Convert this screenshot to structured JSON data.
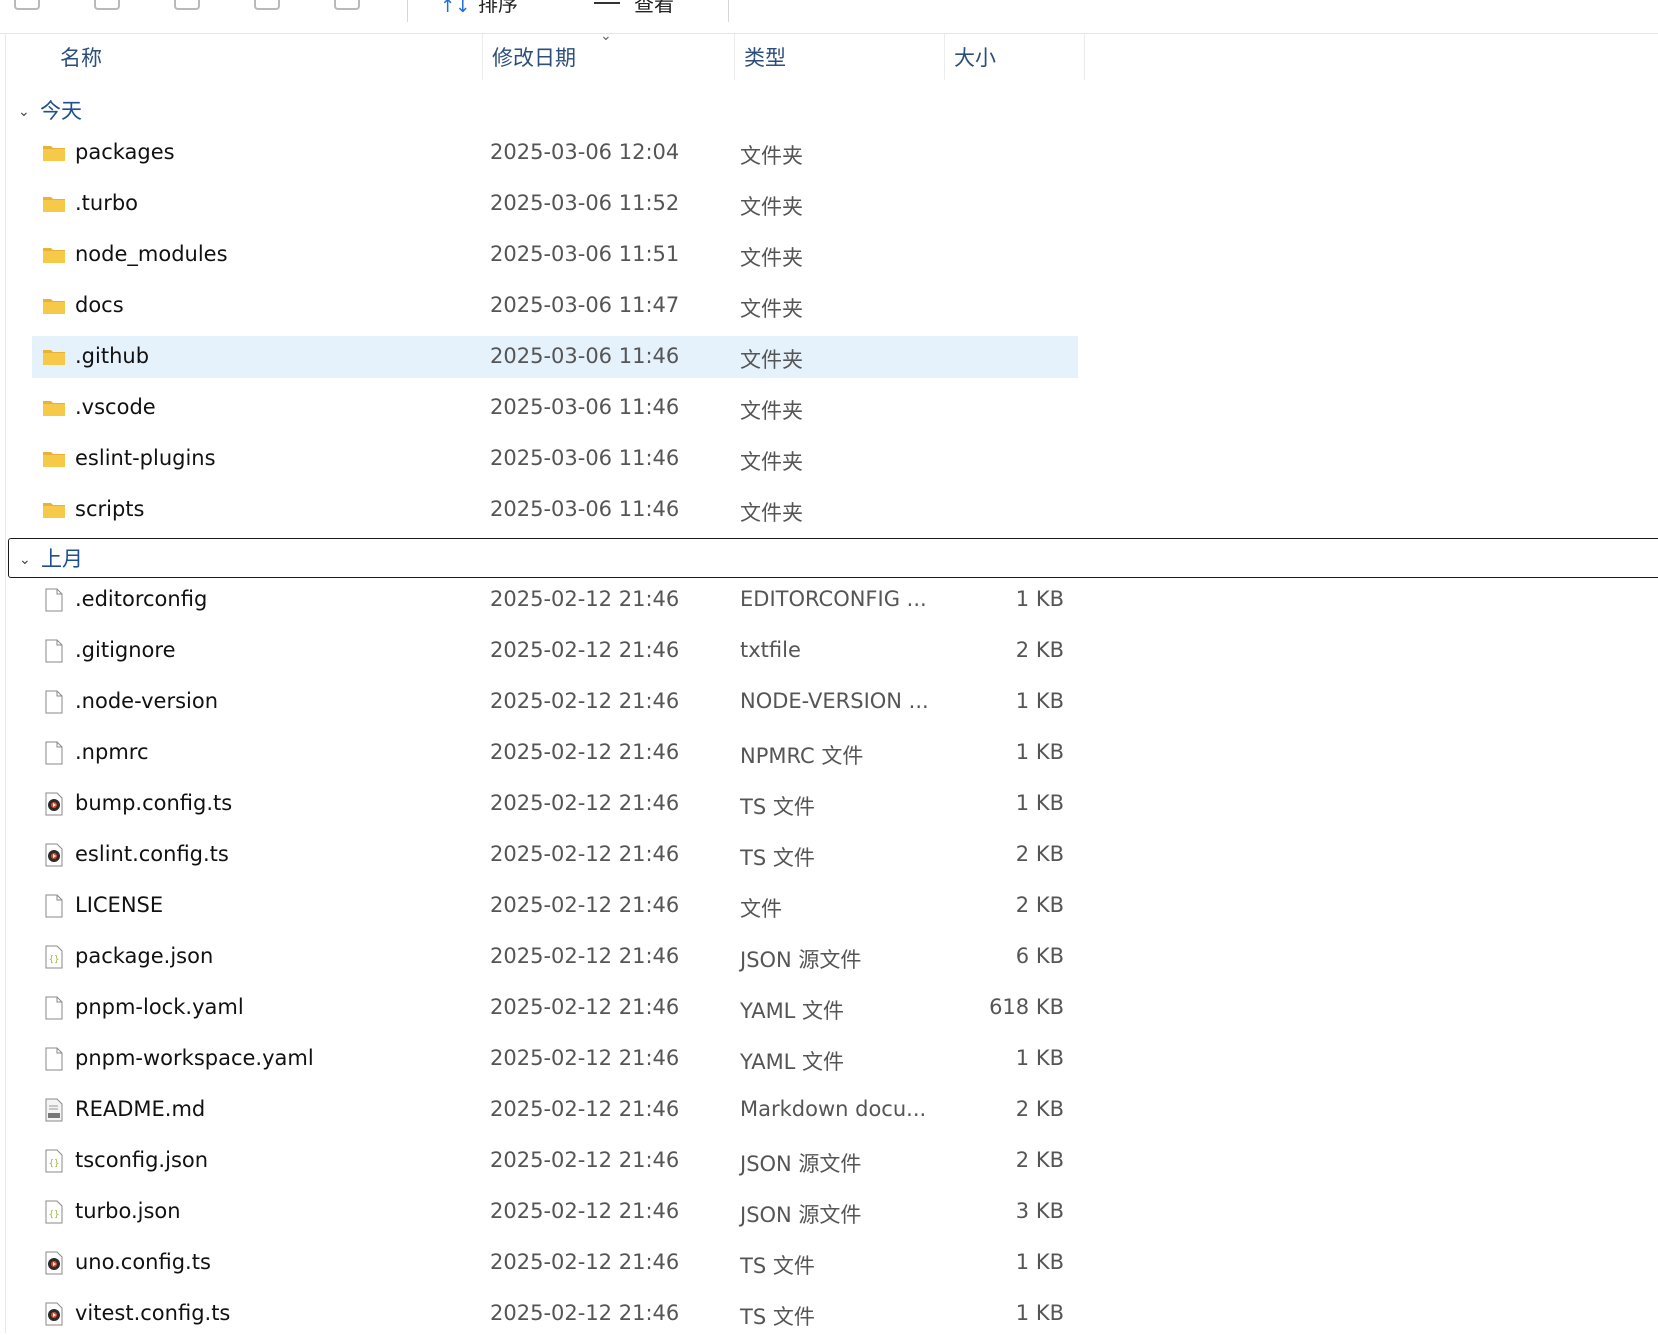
{
  "toolbar": {
    "sort_label": "排序",
    "view_label": "查看"
  },
  "columns": {
    "name": "名称",
    "date": "修改日期",
    "type": "类型",
    "size": "大小"
  },
  "groups": [
    {
      "label": "今天",
      "items": [
        {
          "name": "packages",
          "date": "2025-03-06 12:04",
          "type": "文件夹",
          "size": "",
          "icon": "folder-icon"
        },
        {
          "name": ".turbo",
          "date": "2025-03-06 11:52",
          "type": "文件夹",
          "size": "",
          "icon": "folder-icon"
        },
        {
          "name": "node_modules",
          "date": "2025-03-06 11:51",
          "type": "文件夹",
          "size": "",
          "icon": "folder-icon"
        },
        {
          "name": "docs",
          "date": "2025-03-06 11:47",
          "type": "文件夹",
          "size": "",
          "icon": "folder-icon"
        },
        {
          "name": ".github",
          "date": "2025-03-06 11:46",
          "type": "文件夹",
          "size": "",
          "icon": "folder-icon",
          "selected": true
        },
        {
          "name": ".vscode",
          "date": "2025-03-06 11:46",
          "type": "文件夹",
          "size": "",
          "icon": "folder-icon"
        },
        {
          "name": "eslint-plugins",
          "date": "2025-03-06 11:46",
          "type": "文件夹",
          "size": "",
          "icon": "folder-icon"
        },
        {
          "name": "scripts",
          "date": "2025-03-06 11:46",
          "type": "文件夹",
          "size": "",
          "icon": "folder-icon"
        }
      ]
    },
    {
      "label": "上月",
      "items": [
        {
          "name": ".editorconfig",
          "date": "2025-02-12 21:46",
          "type": "EDITORCONFIG ...",
          "size": "1 KB",
          "icon": "file-icon"
        },
        {
          "name": ".gitignore",
          "date": "2025-02-12 21:46",
          "type": "txtfile",
          "size": "2 KB",
          "icon": "file-icon"
        },
        {
          "name": ".node-version",
          "date": "2025-02-12 21:46",
          "type": "NODE-VERSION ...",
          "size": "1 KB",
          "icon": "file-icon"
        },
        {
          "name": ".npmrc",
          "date": "2025-02-12 21:46",
          "type": "NPMRC 文件",
          "size": "1 KB",
          "icon": "file-icon"
        },
        {
          "name": "bump.config.ts",
          "date": "2025-02-12 21:46",
          "type": "TS 文件",
          "size": "1 KB",
          "icon": "media-file-icon"
        },
        {
          "name": "eslint.config.ts",
          "date": "2025-02-12 21:46",
          "type": "TS 文件",
          "size": "2 KB",
          "icon": "media-file-icon"
        },
        {
          "name": "LICENSE",
          "date": "2025-02-12 21:46",
          "type": "文件",
          "size": "2 KB",
          "icon": "file-icon"
        },
        {
          "name": "package.json",
          "date": "2025-02-12 21:46",
          "type": "JSON 源文件",
          "size": "6 KB",
          "icon": "json-file-icon"
        },
        {
          "name": "pnpm-lock.yaml",
          "date": "2025-02-12 21:46",
          "type": "YAML 文件",
          "size": "618 KB",
          "icon": "file-icon"
        },
        {
          "name": "pnpm-workspace.yaml",
          "date": "2025-02-12 21:46",
          "type": "YAML 文件",
          "size": "1 KB",
          "icon": "file-icon"
        },
        {
          "name": "README.md",
          "date": "2025-02-12 21:46",
          "type": "Markdown docu...",
          "size": "2 KB",
          "icon": "markdown-file-icon"
        },
        {
          "name": "tsconfig.json",
          "date": "2025-02-12 21:46",
          "type": "JSON 源文件",
          "size": "2 KB",
          "icon": "json-file-icon"
        },
        {
          "name": "turbo.json",
          "date": "2025-02-12 21:46",
          "type": "JSON 源文件",
          "size": "3 KB",
          "icon": "json-file-icon"
        },
        {
          "name": "uno.config.ts",
          "date": "2025-02-12 21:46",
          "type": "TS 文件",
          "size": "1 KB",
          "icon": "media-file-icon"
        },
        {
          "name": "vitest.config.ts",
          "date": "2025-02-12 21:46",
          "type": "TS 文件",
          "size": "1 KB",
          "icon": "media-file-icon"
        }
      ]
    }
  ],
  "colors": {
    "selected_row": "#e5f1fb",
    "folder": "#f7c948",
    "group_header": "#1d4f91"
  }
}
